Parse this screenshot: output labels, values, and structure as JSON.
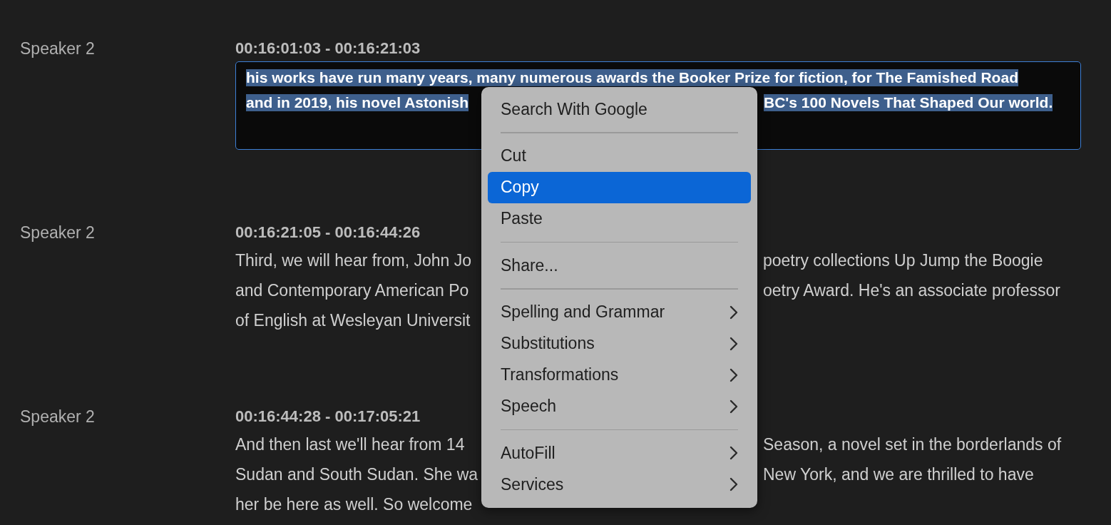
{
  "entries": [
    {
      "speaker": "Speaker 2",
      "timecode": "00:16:01:03 - 00:16:21:03",
      "editing": true,
      "text_selected": true,
      "lines": [
        {
          "left": "his works have run many years, many numerous awards the Booker Prize for fiction, for The Famished Road"
        },
        {
          "left": "and in 2019, his novel Astonish",
          "right": "BC's 100 Novels That Shaped Our world."
        }
      ]
    },
    {
      "speaker": "Speaker 2",
      "timecode": "00:16:21:05 - 00:16:44:26",
      "editing": false,
      "text_selected": false,
      "lines": [
        {
          "left": "Third, we will hear from, John Jo",
          "right": "poetry collections Up Jump the Boogie"
        },
        {
          "left": "and Contemporary American Po",
          "right": "oetry Award. He's an associate professor"
        },
        {
          "left": "of English at Wesleyan Universit"
        }
      ]
    },
    {
      "speaker": "Speaker 2",
      "timecode": "00:16:44:28 - 00:17:05:21",
      "editing": false,
      "text_selected": false,
      "lines": [
        {
          "left": "And then last we'll hear from 14",
          "right": "Season, a novel set in the borderlands of"
        },
        {
          "left": "Sudan and South Sudan. She wa",
          "right": "New York, and we are thrilled to have"
        },
        {
          "left": "her be here as well. So welcome"
        }
      ]
    }
  ],
  "context_menu": {
    "groups": [
      [
        {
          "label": "Search With Google",
          "selected": false,
          "submenu": false
        }
      ],
      [
        {
          "label": "Cut",
          "selected": false,
          "submenu": false
        },
        {
          "label": "Copy",
          "selected": true,
          "submenu": false
        },
        {
          "label": "Paste",
          "selected": false,
          "submenu": false
        }
      ],
      [
        {
          "label": "Share...",
          "selected": false,
          "submenu": false
        }
      ],
      [
        {
          "label": "Spelling and Grammar",
          "selected": false,
          "submenu": true
        },
        {
          "label": "Substitutions",
          "selected": false,
          "submenu": true
        },
        {
          "label": "Transformations",
          "selected": false,
          "submenu": true
        },
        {
          "label": "Speech",
          "selected": false,
          "submenu": true
        }
      ],
      [
        {
          "label": "AutoFill",
          "selected": false,
          "submenu": true
        },
        {
          "label": "Services",
          "selected": false,
          "submenu": true
        }
      ]
    ]
  }
}
